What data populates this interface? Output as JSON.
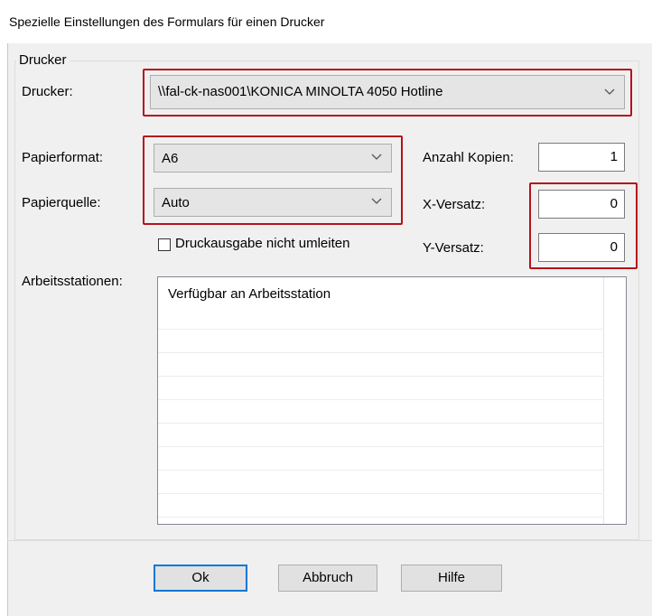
{
  "window": {
    "title": "Spezielle Einstellungen des Formulars für einen Drucker"
  },
  "group": {
    "legend": "Drucker"
  },
  "printer": {
    "label": "Drucker:",
    "value": "\\\\fal-ck-nas001\\KONICA MINOLTA 4050 Hotline"
  },
  "paper_format": {
    "label": "Papierformat:",
    "value": "A6"
  },
  "paper_source": {
    "label": "Papierquelle:",
    "value": "Auto"
  },
  "copies": {
    "label": "Anzahl Kopien:",
    "value": "1"
  },
  "x_offset": {
    "label": "X-Versatz:",
    "value": "0"
  },
  "y_offset": {
    "label": "Y-Versatz:",
    "value": "0"
  },
  "redirect": {
    "label": "Druckausgabe nicht umleiten",
    "checked": false
  },
  "workstations": {
    "label": "Arbeitsstationen:",
    "column_header": "Verfügbar an Arbeitsstation"
  },
  "buttons": {
    "ok": "Ok",
    "cancel": "Abbruch",
    "help": "Hilfe"
  },
  "colors": {
    "highlight": "#b5121b",
    "default_button_border": "#0078d7",
    "dialog_bg": "#f0f0f0"
  }
}
